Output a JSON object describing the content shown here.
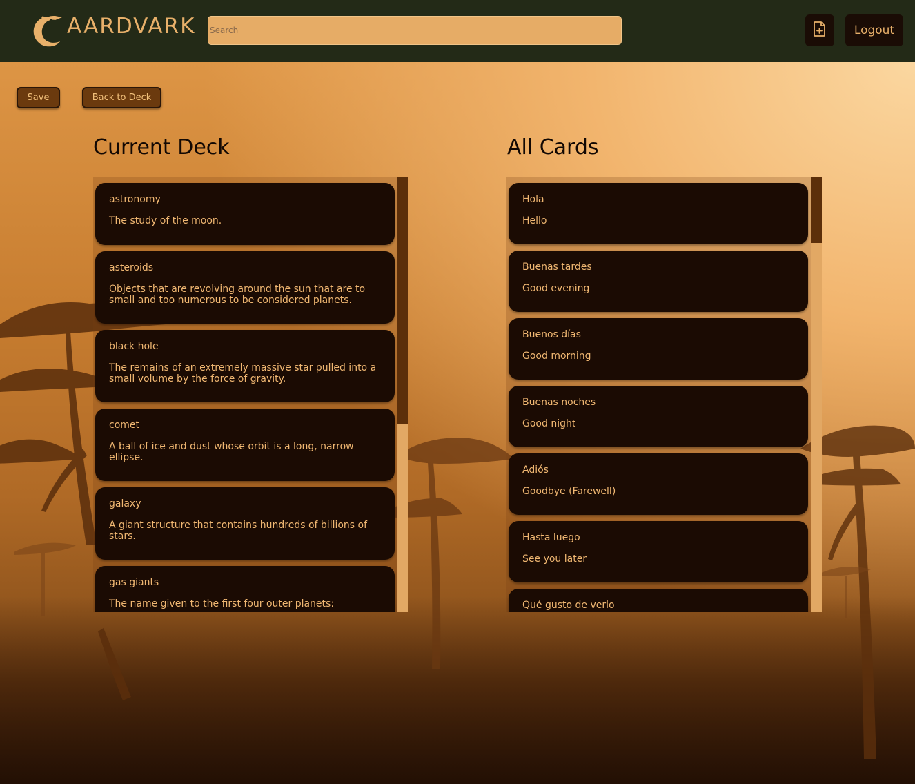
{
  "app": {
    "brand": "AARDVARK",
    "search_placeholder": "Search",
    "new_card_icon": "file-plus-icon",
    "logout_label": "Logout"
  },
  "actions": {
    "save_label": "Save",
    "back_label": "Back to Deck"
  },
  "current_deck": {
    "title": "Current Deck",
    "cards": [
      {
        "term": "astronomy",
        "definition": "The study of the moon."
      },
      {
        "term": "asteroids",
        "definition": "Objects that are revolving around the sun that are to small and too numerous to be considered planets."
      },
      {
        "term": "black hole",
        "definition": "The remains of an extremely massive star pulled into a small volume by the force of gravity."
      },
      {
        "term": "comet",
        "definition": "A ball of ice and dust whose orbit is a long, narrow ellipse."
      },
      {
        "term": "galaxy",
        "definition": "A giant structure that contains hundreds of billions of stars."
      },
      {
        "term": "gas giants",
        "definition": "The name given to the first four outer planets:"
      }
    ]
  },
  "all_cards": {
    "title": "All Cards",
    "cards": [
      {
        "term": "Hola",
        "definition": "Hello"
      },
      {
        "term": "Buenas tardes",
        "definition": "Good evening"
      },
      {
        "term": "Buenos días",
        "definition": "Good morning"
      },
      {
        "term": "Buenas noches",
        "definition": "Good night"
      },
      {
        "term": "Adiós",
        "definition": "Goodbye (Farewell)"
      },
      {
        "term": "Hasta luego",
        "definition": "See you later"
      },
      {
        "term": "Qué gusto de verlo",
        "definition": ""
      }
    ]
  },
  "colors": {
    "header_bg": "#232a17",
    "accent": "#e8b06a",
    "card_bg": "#1b0b03",
    "button_bg": "#6b3a0e"
  }
}
